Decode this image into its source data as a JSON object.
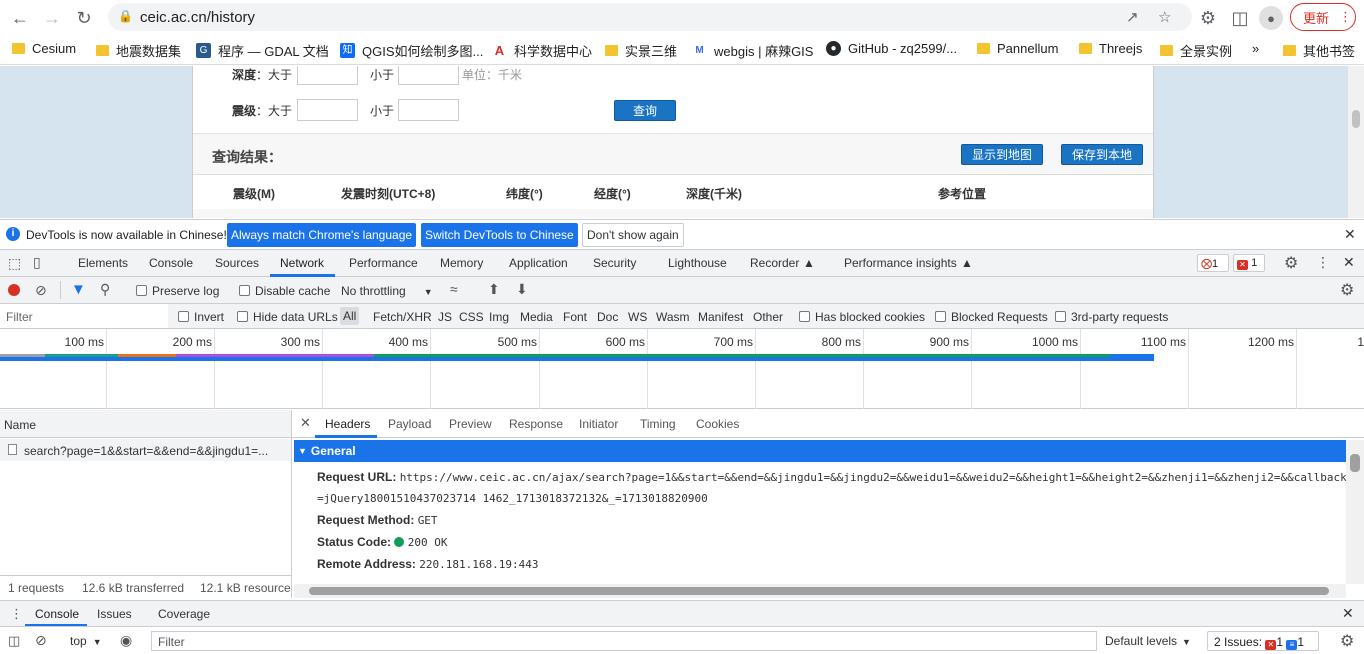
{
  "browser": {
    "url": "ceic.ac.cn/history",
    "update_label": "更新"
  },
  "bookmarks": [
    {
      "label": "Cesium",
      "icon": "folder-icon"
    },
    {
      "label": "地震数据集",
      "icon": "folder-icon"
    },
    {
      "label": "程序 — GDAL 文档",
      "icon": "gdal-icon"
    },
    {
      "label": "QGIS如何绘制多图...",
      "icon": "zhihu-icon"
    },
    {
      "label": "科学数据中心",
      "icon": "red-logo-icon"
    },
    {
      "label": "实景三维",
      "icon": "folder-icon"
    },
    {
      "label": "webgis | 麻辣GIS",
      "icon": "mlgis-icon"
    },
    {
      "label": "GitHub - zq2599/...",
      "icon": "github-icon"
    },
    {
      "label": "Pannellum",
      "icon": "folder-icon"
    },
    {
      "label": "Threejs",
      "icon": "folder-icon"
    },
    {
      "label": "全景实例",
      "icon": "folder-icon"
    },
    {
      "label": "»",
      "icon": ""
    },
    {
      "label": "其他书签",
      "icon": "folder-icon"
    }
  ],
  "page": {
    "depth_label": "深度",
    "gt_label": "：大于",
    "lt_label": "小于",
    "unit_label": "单位：千米",
    "magnitude_label": "震级",
    "query_button": "查询",
    "results_label": "查询结果：",
    "show_map_button": "显示到地图",
    "save_local_button": "保存到本地",
    "columns": [
      "震级(M)",
      "发震时刻(UTC+8)",
      "纬度(°)",
      "经度(°)",
      "深度(千米)",
      "参考位置"
    ]
  },
  "infobar": {
    "message": "DevTools is now available in Chinese!",
    "btn_match": "Always match Chrome's language",
    "btn_switch": "Switch DevTools to Chinese",
    "btn_dont": "Don't show again"
  },
  "devtools": {
    "tabs": [
      "Elements",
      "Console",
      "Sources",
      "Network",
      "Performance",
      "Memory",
      "Application",
      "Security",
      "Lighthouse",
      "Recorder",
      "Performance insights"
    ],
    "active_tab": "Network",
    "error_count": "1",
    "issue_count": "1",
    "toolbar": {
      "preserve_log": "Preserve log",
      "disable_cache": "Disable cache",
      "throttling": "No throttling"
    },
    "filter": {
      "placeholder": "Filter",
      "invert": "Invert",
      "hide_data_urls": "Hide data URLs",
      "types": [
        "All",
        "Fetch/XHR",
        "JS",
        "CSS",
        "Img",
        "Media",
        "Font",
        "Doc",
        "WS",
        "Wasm",
        "Manifest",
        "Other"
      ],
      "has_blocked_cookies": "Has blocked cookies",
      "blocked_requests": "Blocked Requests",
      "third_party": "3rd-party requests"
    },
    "timeline_ticks": [
      "100 ms",
      "200 ms",
      "300 ms",
      "400 ms",
      "500 ms",
      "600 ms",
      "700 ms",
      "800 ms",
      "900 ms",
      "1000 ms",
      "1100 ms",
      "1200 ms",
      "1"
    ],
    "requests": {
      "name_header": "Name",
      "items": [
        "search?page=1&&start=&&end=&&jingdu1=..."
      ],
      "summary": [
        "1 requests",
        "12.6 kB transferred",
        "12.1 kB resource"
      ]
    },
    "detail_tabs": [
      "Headers",
      "Payload",
      "Preview",
      "Response",
      "Initiator",
      "Timing",
      "Cookies"
    ],
    "active_detail_tab": "Headers",
    "general_label": "General",
    "headers": {
      "request_url_label": "Request URL:",
      "request_url_line1": "https://www.ceic.ac.cn/ajax/search?page=1&&start=&&end=&&jingdu1=&&jingdu2=&&weidu1=&&weidu2=&&height1=&&height2=&&zhenji1=&&zhenji2=&&callback",
      "request_url_line2": "=jQuery18001510437023714 1462_1713018372132&_=1713018820900",
      "request_method_label": "Request Method:",
      "request_method": "GET",
      "status_code_label": "Status Code:",
      "status_code": "200 OK",
      "remote_address_label": "Remote Address:",
      "remote_address": "220.181.168.19:443"
    },
    "drawer": {
      "tabs": [
        "Console",
        "Issues",
        "Coverage"
      ],
      "context": "top",
      "filter_placeholder": "Filter",
      "levels": "Default levels",
      "issues": "2 Issues:",
      "issue_err": "1",
      "issue_info": "1"
    }
  }
}
